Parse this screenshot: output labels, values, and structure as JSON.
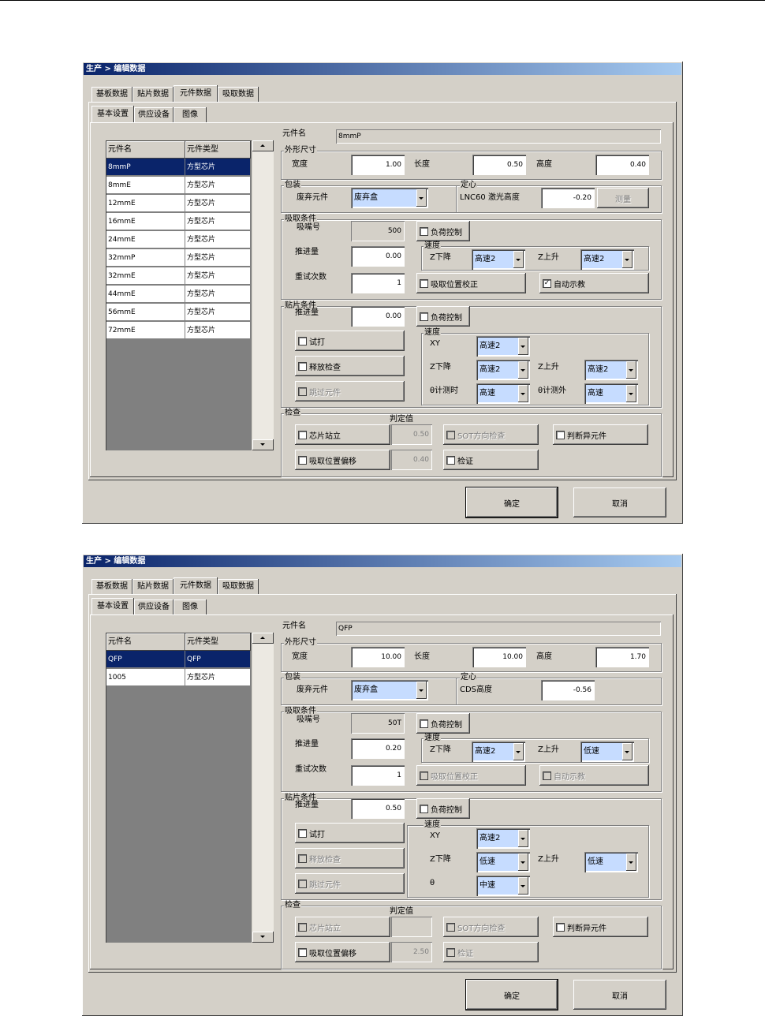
{
  "dialogs": [
    {
      "title": "生产 > 编辑数据",
      "tabs": [
        "基板数据",
        "贴片数据",
        "元件数据",
        "吸取数据"
      ],
      "subtabs": [
        "基本设置",
        "供应设备",
        "图像"
      ],
      "grid": {
        "headers": [
          "元件名",
          "元件类型"
        ],
        "rows": [
          [
            "8mmP",
            "方型芯片"
          ],
          [
            "8mmE",
            "方型芯片"
          ],
          [
            "12mmE",
            "方型芯片"
          ],
          [
            "16mmE",
            "方型芯片"
          ],
          [
            "24mmE",
            "方型芯片"
          ],
          [
            "32mmP",
            "方型芯片"
          ],
          [
            "32mmE",
            "方型芯片"
          ],
          [
            "44mmE",
            "方型芯片"
          ],
          [
            "56mmE",
            "方型芯片"
          ],
          [
            "72mmE",
            "方型芯片"
          ]
        ]
      },
      "name_label": "元件名",
      "name_value": "8mmP",
      "dims": {
        "label": "外形尺寸",
        "width_label": "宽度",
        "width": "1.00",
        "length_label": "长度",
        "length": "0.50",
        "height_label": "高度",
        "height": "0.40"
      },
      "pkg": {
        "label": "包装",
        "waste_label": "废弃元件",
        "waste": "废弃盒"
      },
      "center": {
        "label": "定心",
        "sensor_label": "LNC60 激光高度",
        "sensor_value": "-0.20",
        "measure_button": "测量"
      },
      "pick": {
        "label": "吸取条件",
        "nozzle_label": "吸嘴号",
        "nozzle": "500",
        "load_control": "负荷控制",
        "push_label": "推进量",
        "push": "0.00",
        "speed_label": "速度",
        "zdown_label": "Z下降",
        "zdown": "高速2",
        "zup_label": "Z上升",
        "zup": "高速2",
        "retry_label": "重试次数",
        "retry": "1",
        "pos_correct": "吸取位置校正",
        "auto_teach": "自动示教"
      },
      "mount": {
        "label": "贴片条件",
        "push_label": "推进量",
        "push": "0.00",
        "load_control": "负荷控制",
        "trial": "试打",
        "release_check": "释放检查",
        "skip": "跳过元件",
        "speed_label": "速度",
        "xy_label": "XY",
        "xy": "高速2",
        "zdown_label": "Z下降",
        "zdown": "高速2",
        "zup_label": "Z上升",
        "zup": "高速2",
        "theta1_label": "θ计测时",
        "theta1": "高速",
        "theta2_label": "θ计测外",
        "theta2": "高速"
      },
      "inspect": {
        "label": "检查",
        "judge_label": "判定值",
        "standup": "芯片站立",
        "standup_value": "0.50",
        "sot": "SOT方向检查",
        "abnormal": "判断异元件",
        "offset": "吸取位置偏移",
        "offset_value": "0.40",
        "verify": "检证"
      },
      "ok": "确定",
      "cancel": "取消"
    },
    {
      "title": "生产 > 编辑数据",
      "tabs": [
        "基板数据",
        "贴片数据",
        "元件数据",
        "吸取数据"
      ],
      "subtabs": [
        "基本设置",
        "供应设备",
        "图像"
      ],
      "grid": {
        "headers": [
          "元件名",
          "元件类型"
        ],
        "rows": [
          [
            "QFP",
            "QFP"
          ],
          [
            "1005",
            "方型芯片"
          ]
        ]
      },
      "name_label": "元件名",
      "name_value": "QFP",
      "dims": {
        "label": "外形尺寸",
        "width_label": "宽度",
        "width": "10.00",
        "length_label": "长度",
        "length": "10.00",
        "height_label": "高度",
        "height": "1.70"
      },
      "pkg": {
        "label": "包装",
        "waste_label": "废弃元件",
        "waste": "废弃盒"
      },
      "center": {
        "label": "定心",
        "sensor_label": "CDS高度",
        "sensor_value": "-0.56"
      },
      "pick": {
        "label": "吸取条件",
        "nozzle_label": "吸嘴号",
        "nozzle": "50T",
        "load_control": "负荷控制",
        "push_label": "推进量",
        "push": "0.20",
        "speed_label": "速度",
        "zdown_label": "Z下降",
        "zdown": "高速2",
        "zup_label": "Z上升",
        "zup": "低速",
        "retry_label": "重试次数",
        "retry": "1",
        "pos_correct": "吸取位置校正",
        "auto_teach": "自动示教"
      },
      "mount": {
        "label": "贴片条件",
        "push_label": "推进量",
        "push": "0.50",
        "load_control": "负荷控制",
        "trial": "试打",
        "release_check": "释放检查",
        "skip": "跳过元件",
        "speed_label": "速度",
        "xy_label": "XY",
        "xy": "高速2",
        "zdown_label": "Z下降",
        "zdown": "低速",
        "zup_label": "Z上升",
        "zup": "低速",
        "theta_label": "θ",
        "theta": "中速"
      },
      "inspect": {
        "label": "检查",
        "judge_label": "判定值",
        "standup": "芯片站立",
        "standup_value": "",
        "sot": "SOT方向检查",
        "abnormal": "判断异元件",
        "offset": "吸取位置偏移",
        "offset_value": "2.50",
        "verify": "检证"
      },
      "ok": "确定",
      "cancel": "取消"
    }
  ]
}
